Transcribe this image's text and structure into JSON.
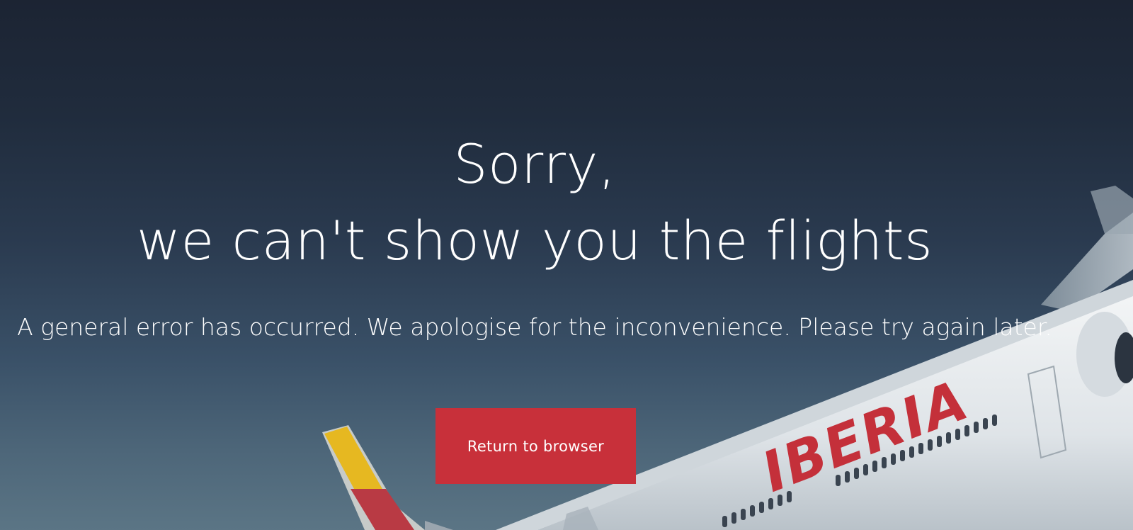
{
  "error_page": {
    "title_line_1": "Sorry,",
    "title_line_2": "we can't show you the flights",
    "message": "A general error has occurred. We apologise for the inconvenience. Please try again later.",
    "return_button_label": "Return to browser"
  },
  "background": {
    "description_icon": "airplane-illustration",
    "livery_text": "IBERIA",
    "colors": {
      "sky_top": "#1c2433",
      "sky_bottom": "#5b7585",
      "fuselage": "#e8ecef",
      "livery_red": "#c4303a",
      "livery_yellow": "#e6b821",
      "button": "#c8303a"
    }
  }
}
